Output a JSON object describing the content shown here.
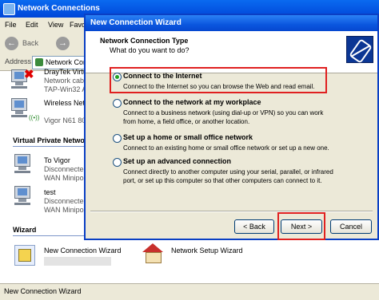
{
  "background_window": {
    "title": "Network Connections",
    "menu": [
      "File",
      "Edit",
      "View",
      "Favor"
    ],
    "back_label": "Back",
    "address_label": "Address",
    "address_value": "Network Conn",
    "connections": [
      {
        "name": "DrayTek Virtua",
        "status": "Network cable",
        "device": "TAP-Win32 Ada"
      },
      {
        "name": "Wireless Netwo",
        "status": "",
        "device": "Vigor N61 802."
      }
    ],
    "vpn_group": "Virtual Private Network",
    "vpn": [
      {
        "name": "To Vigor",
        "status": "Disconnected",
        "device": "WAN Miniport ("
      },
      {
        "name": "test",
        "status": "Disconnected",
        "device": "WAN Miniport ("
      }
    ],
    "wizard_group": "Wizard",
    "wizards": [
      "New Connection Wizard",
      "Network Setup Wizard"
    ],
    "status_bar": "New Connection Wizard"
  },
  "dialog": {
    "title": "New Connection Wizard",
    "header_title": "Network Connection Type",
    "header_subtitle": "What do you want to do?",
    "options": [
      {
        "label": "Connect to the Internet",
        "desc": "Connect to the Internet so you can browse the Web and read email.",
        "selected": true
      },
      {
        "label": "Connect to the network at my workplace",
        "desc": "Connect to a business network (using dial-up or VPN) so you can work from home, a field office, or another location.",
        "selected": false
      },
      {
        "label": "Set up a home or small office network",
        "desc": "Connect to an existing home or small office network or set up a new one.",
        "selected": false
      },
      {
        "label": "Set up an advanced connection",
        "desc": "Connect directly to another computer using your serial, parallel, or infrared port, or set up this computer so that other computers can connect to it.",
        "selected": false
      }
    ],
    "buttons": {
      "back": "< Back",
      "next": "Next >",
      "cancel": "Cancel"
    }
  }
}
